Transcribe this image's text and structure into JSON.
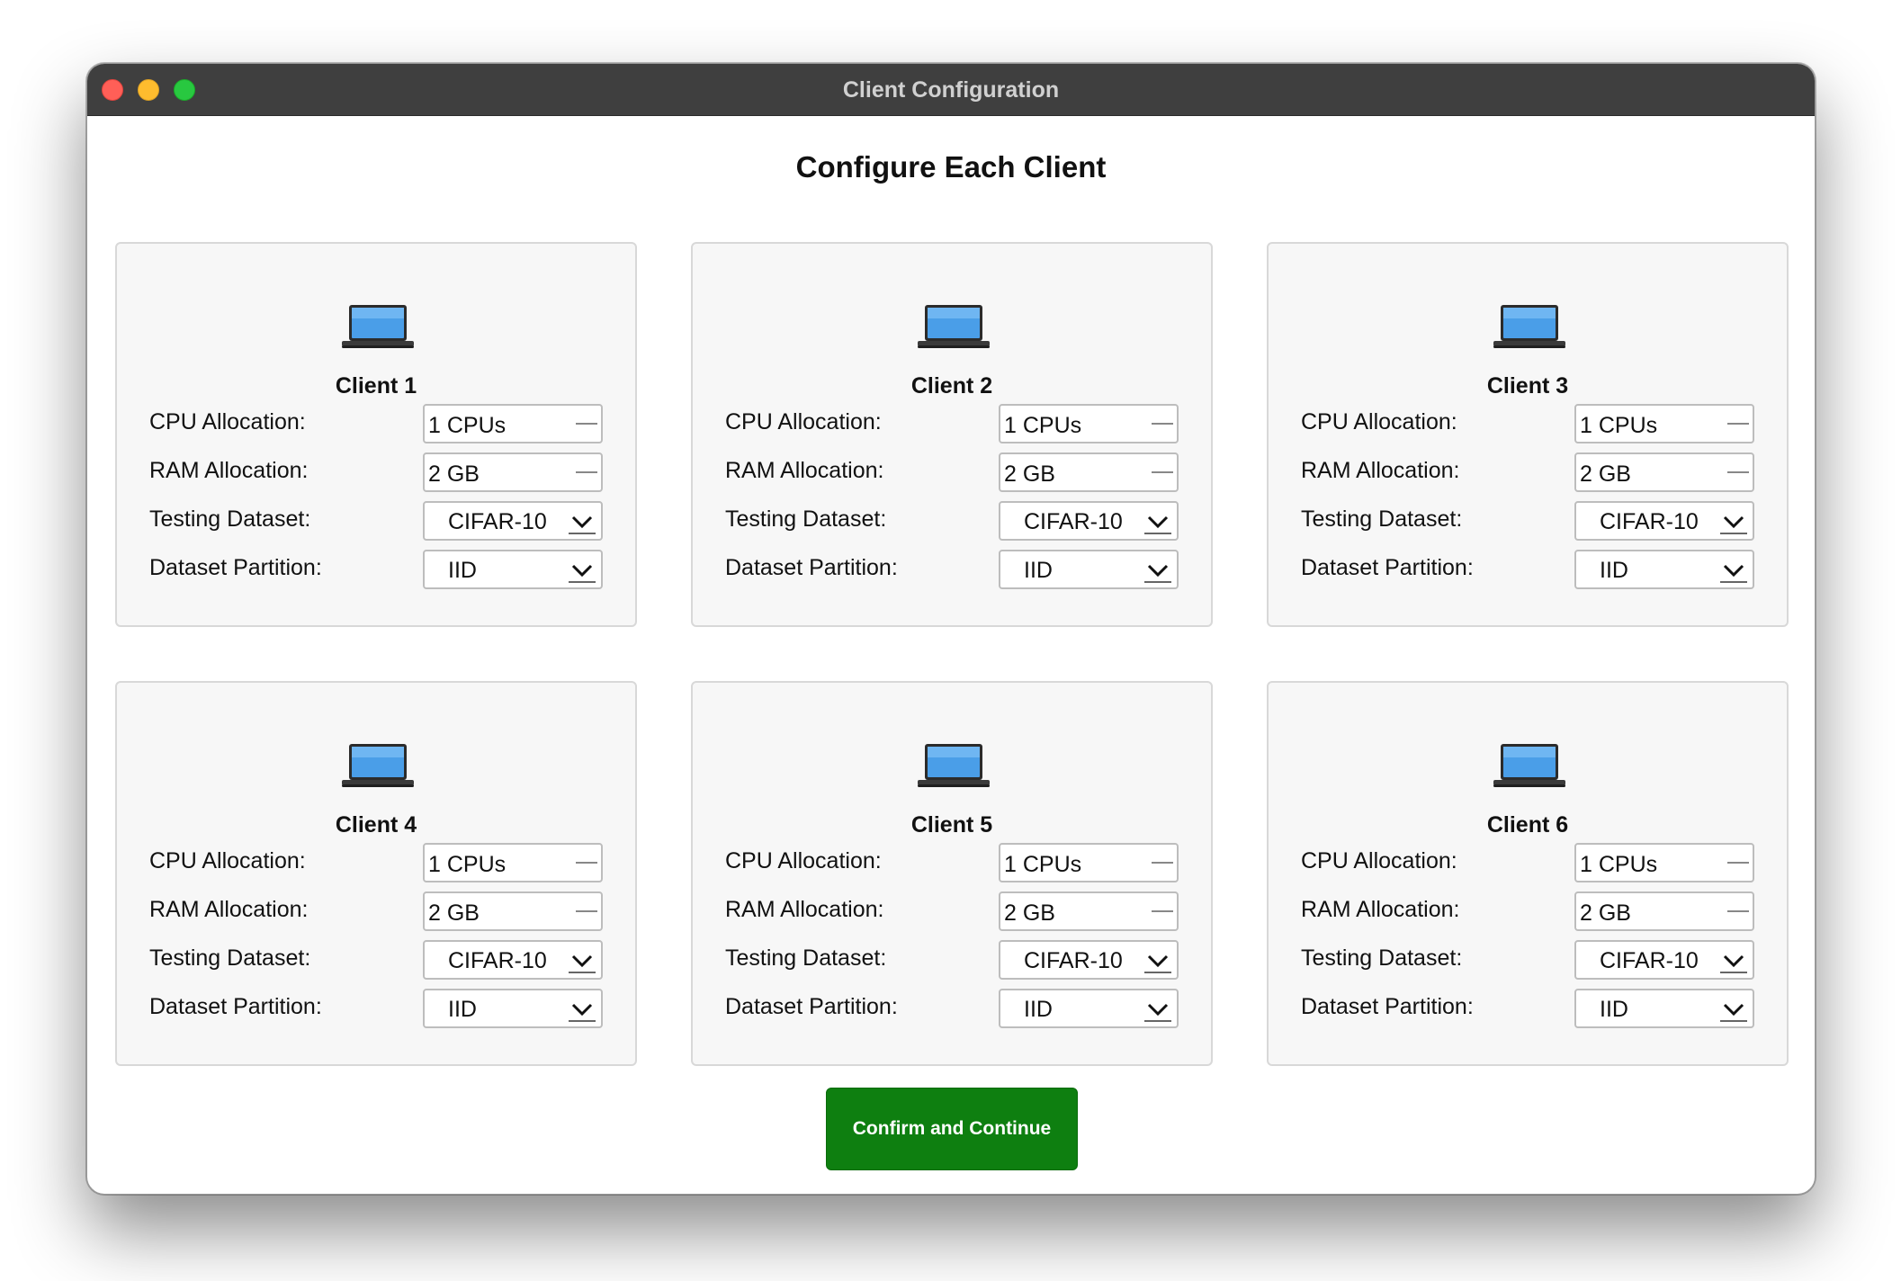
{
  "window": {
    "title": "Client Configuration"
  },
  "heading": "Configure Each Client",
  "labels": {
    "cpu": "CPU Allocation:",
    "ram": "RAM Allocation:",
    "dataset": "Testing Dataset:",
    "partition": "Dataset Partition:"
  },
  "clients": [
    {
      "name": "Client 1",
      "cpu": "1 CPUs",
      "ram": "2 GB",
      "dataset": "CIFAR-10",
      "partition": "IID"
    },
    {
      "name": "Client 2",
      "cpu": "1 CPUs",
      "ram": "2 GB",
      "dataset": "CIFAR-10",
      "partition": "IID"
    },
    {
      "name": "Client 3",
      "cpu": "1 CPUs",
      "ram": "2 GB",
      "dataset": "CIFAR-10",
      "partition": "IID"
    },
    {
      "name": "Client 4",
      "cpu": "1 CPUs",
      "ram": "2 GB",
      "dataset": "CIFAR-10",
      "partition": "IID"
    },
    {
      "name": "Client 5",
      "cpu": "1 CPUs",
      "ram": "2 GB",
      "dataset": "CIFAR-10",
      "partition": "IID"
    },
    {
      "name": "Client 6",
      "cpu": "1 CPUs",
      "ram": "2 GB",
      "dataset": "CIFAR-10",
      "partition": "IID"
    }
  ],
  "confirm_button": "Confirm and Continue",
  "icons": {
    "client": "laptop-icon",
    "dropdown": "chevron-down-icon"
  },
  "colors": {
    "confirm": "#0e7f10",
    "titlebar": "#3f3f3f"
  }
}
